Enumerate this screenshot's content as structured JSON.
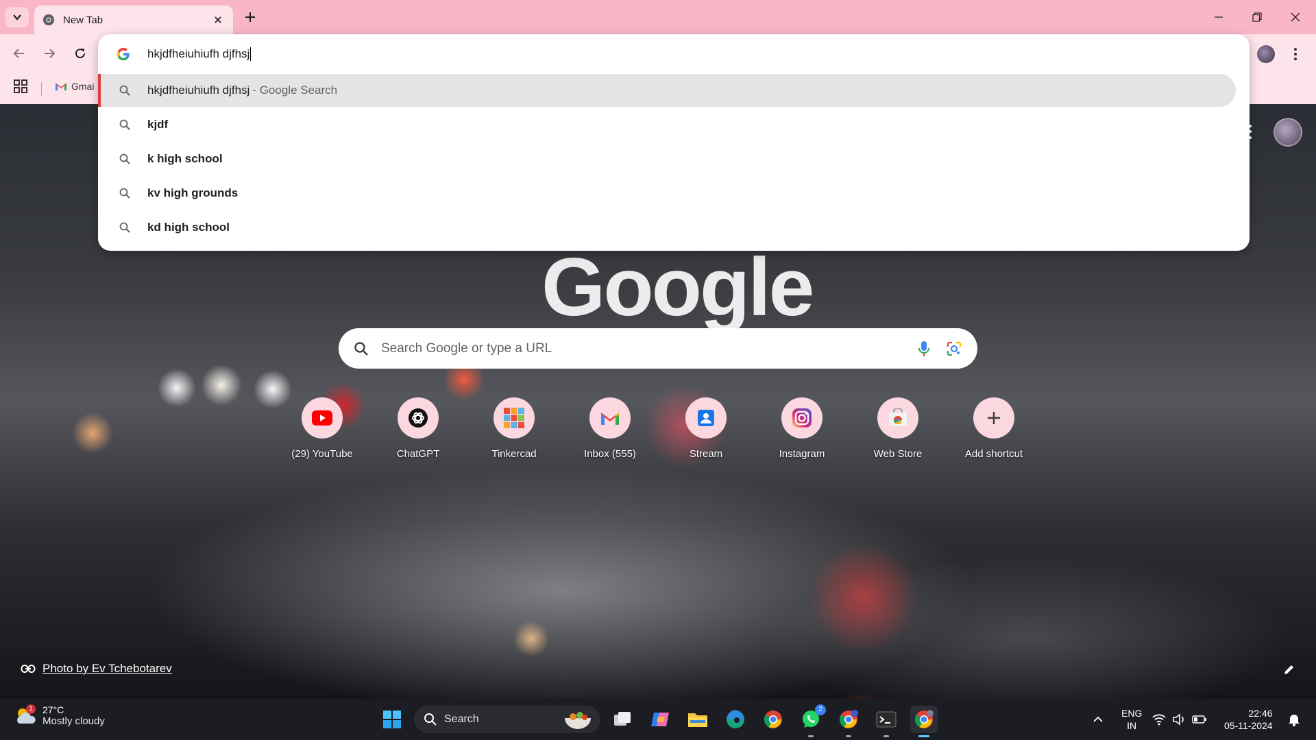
{
  "browser": {
    "tab": {
      "title": "New Tab"
    },
    "bookmarks": {
      "gmail_label": "Gmai"
    }
  },
  "omnibox": {
    "value": "hkjdfheiuhiufh djfhsj",
    "suggestions": [
      {
        "text": "hkjdfheiuhiufh djfhsj",
        "suffix": "- Google Search",
        "bold": false,
        "selected": true
      },
      {
        "text": "kjdf",
        "suffix": "",
        "bold": true,
        "selected": false
      },
      {
        "text": "k high school",
        "suffix": "",
        "bold": true,
        "selected": false
      },
      {
        "text": "kv high grounds",
        "suffix": "",
        "bold": true,
        "selected": false
      },
      {
        "text": "kd high school",
        "suffix": "",
        "bold": true,
        "selected": false
      }
    ]
  },
  "newtab": {
    "logo_text": "Google",
    "search_placeholder": "Search Google or type a URL",
    "shortcuts": [
      {
        "label": "(29) YouTube",
        "icon": "youtube-icon"
      },
      {
        "label": "ChatGPT",
        "icon": "chatgpt-icon"
      },
      {
        "label": "Tinkercad",
        "icon": "tinkercad-icon"
      },
      {
        "label": "Inbox (555)",
        "icon": "gmail-icon"
      },
      {
        "label": "Stream",
        "icon": "stream-icon"
      },
      {
        "label": "Instagram",
        "icon": "instagram-icon"
      },
      {
        "label": "Web Store",
        "icon": "webstore-icon"
      },
      {
        "label": "Add shortcut",
        "icon": "plus-icon"
      }
    ],
    "photo_credit": "Photo by Ev Tchebotarev"
  },
  "taskbar": {
    "weather": {
      "temp": "27°C",
      "desc": "Mostly cloudy",
      "badge": "1"
    },
    "search_label": "Search",
    "whatsapp_badge": "2",
    "lang_line1": "ENG",
    "lang_line2": "IN",
    "time": "22:46",
    "date": "05-11-2024"
  },
  "colors": {
    "chrome_frame": "#f8b6c6",
    "chrome_toolbar": "#fde3ea",
    "selected_indicator": "#d93a3a",
    "taskbar": "#1c1d22"
  }
}
